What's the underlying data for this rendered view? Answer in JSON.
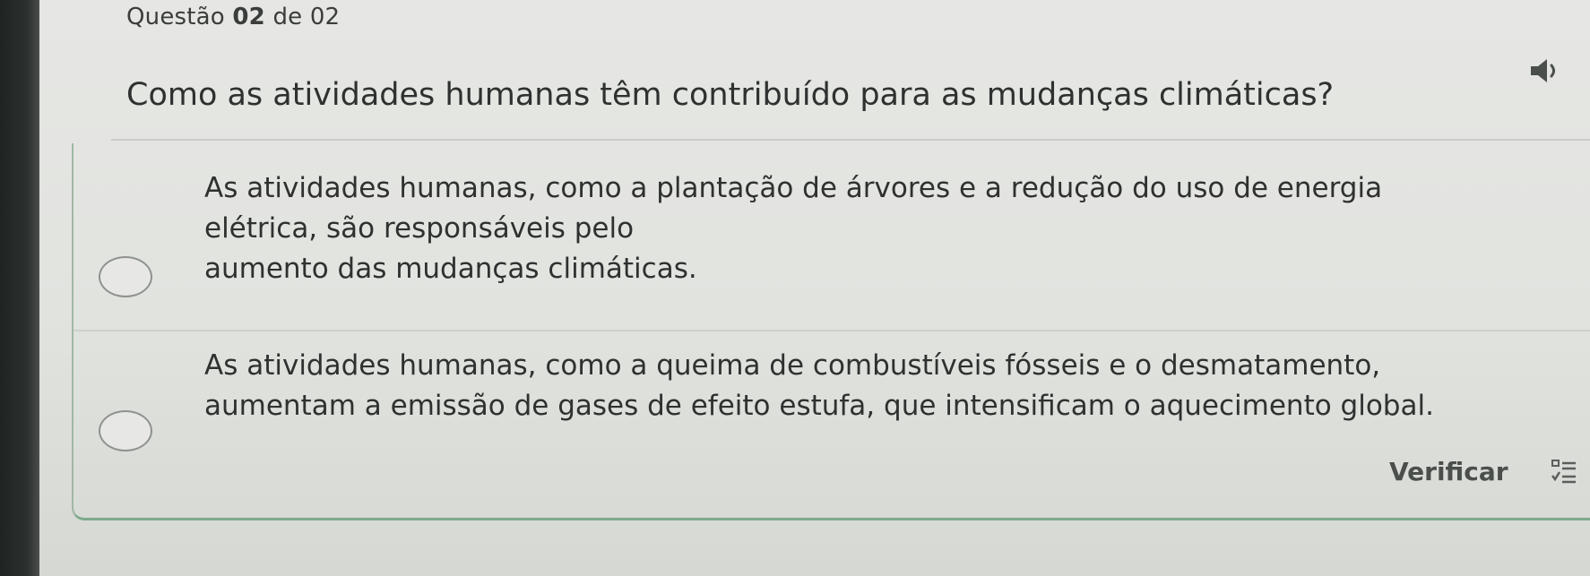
{
  "header": {
    "prefix": "Questão",
    "number": "02",
    "suffix": "de 02"
  },
  "question": {
    "text": "Como as atividades humanas têm contribuído para as mudanças climáticas?",
    "audio_icon": "speaker-icon"
  },
  "options": [
    {
      "lines": [
        "As atividades humanas, como a plantação de árvores e a redução do uso de energia",
        "elétrica, são responsáveis pelo",
        "aumento das mudanças climáticas."
      ],
      "selected": false
    },
    {
      "lines": [
        "As atividades humanas, como a queima de combustíveis fósseis e o desmatamento,",
        "aumentam a emissão de gases de efeito estufa, que intensificam o aquecimento global."
      ],
      "selected": false
    }
  ],
  "actions": {
    "verify_label": "Verificar",
    "verify_icon": "checklist-icon"
  },
  "colors": {
    "accent_border": "#7fa98c",
    "text": "#2e312f"
  }
}
